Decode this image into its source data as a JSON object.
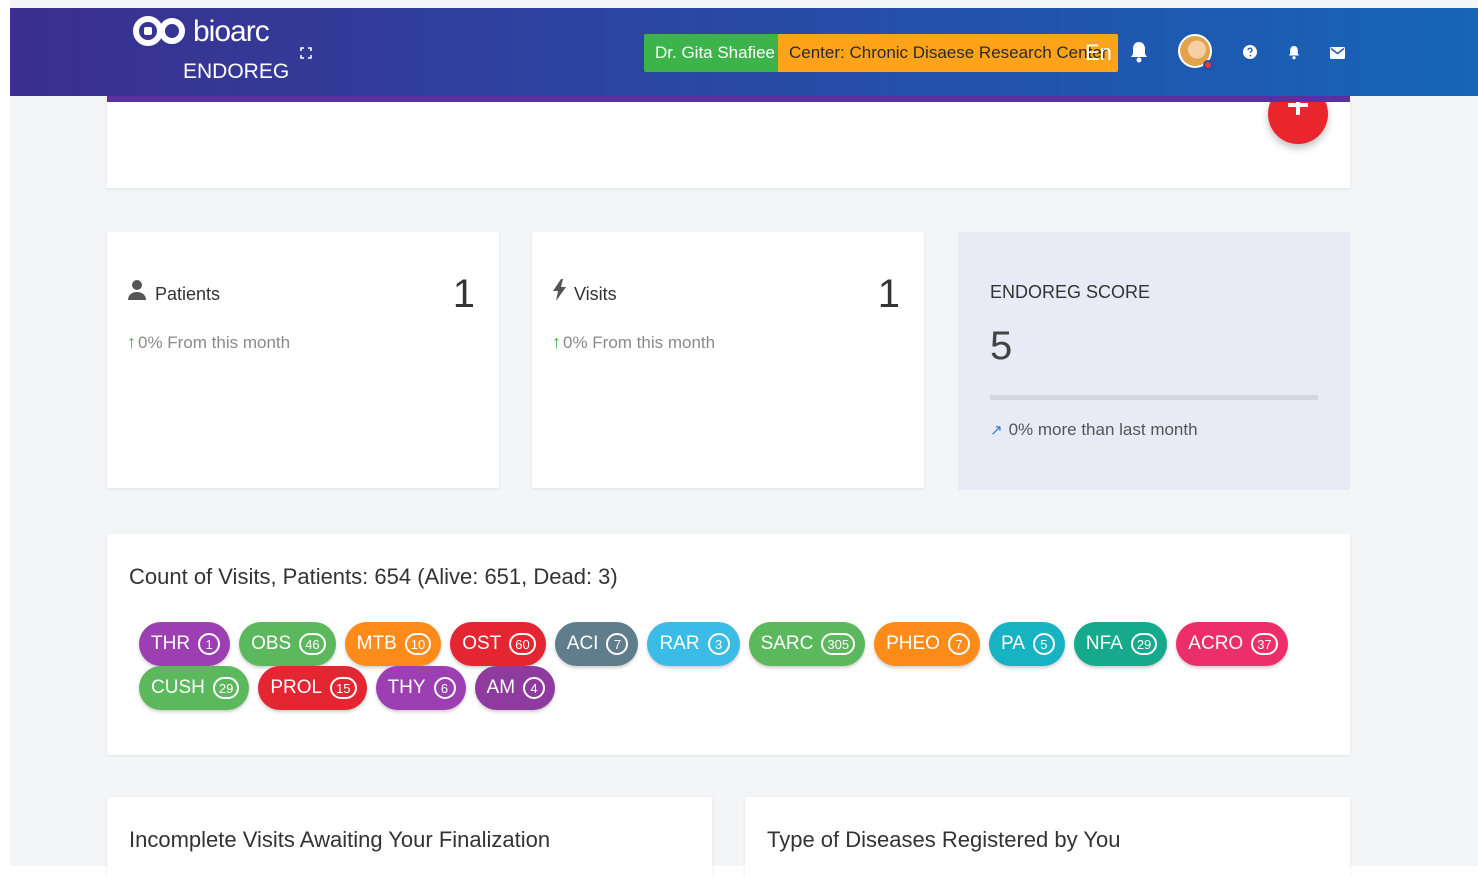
{
  "header": {
    "logo_text": "bioarc",
    "logo_sub": "ENDOREG",
    "doctor": "Dr. Gita Shafiee",
    "center": "Center: Chronic Disaese Research Center",
    "language": "En"
  },
  "stats": {
    "patients": {
      "label": "Patients",
      "value": "1",
      "trend": "0% From this month"
    },
    "visits": {
      "label": "Visits",
      "value": "1",
      "trend": "0% From this month"
    }
  },
  "score": {
    "title": "ENDOREG SCORE",
    "value": "5",
    "trend": "0% more than last month"
  },
  "visits_count": {
    "title": "Count of Visits, Patients: 654 (Alive: 651, Dead: 3)",
    "chips_row1": [
      {
        "label": "THR",
        "count": "1",
        "color": "#9c3fb3"
      },
      {
        "label": "OBS",
        "count": "46",
        "color": "#5cb85c"
      },
      {
        "label": "MTB",
        "count": "10",
        "color": "#ff8c1a"
      },
      {
        "label": "OST",
        "count": "60",
        "color": "#e32631"
      },
      {
        "label": "ACI",
        "count": "7",
        "color": "#5f7d8b"
      },
      {
        "label": "RAR",
        "count": "3",
        "color": "#3bbce6"
      },
      {
        "label": "SARC",
        "count": "305",
        "color": "#5cb85c"
      },
      {
        "label": "PHEO",
        "count": "7",
        "color": "#ff8c1a"
      },
      {
        "label": "PA",
        "count": "5",
        "color": "#17b3c2"
      },
      {
        "label": "NFA",
        "count": "29",
        "color": "#17a98c"
      },
      {
        "label": "ACRO",
        "count": "37",
        "color": "#ec2f6b"
      }
    ],
    "chips_row2": [
      {
        "label": "CUSH",
        "count": "29",
        "color": "#5cb85c"
      },
      {
        "label": "PROL",
        "count": "15",
        "color": "#e32631"
      },
      {
        "label": "THY",
        "count": "6",
        "color": "#9c3fb3"
      },
      {
        "label": "AM",
        "count": "4",
        "color": "#8e3a9e"
      }
    ]
  },
  "bottom": {
    "left_title": "Incomplete Visits Awaiting Your Finalization",
    "right_title": "Type of Diseases Registered by You"
  }
}
